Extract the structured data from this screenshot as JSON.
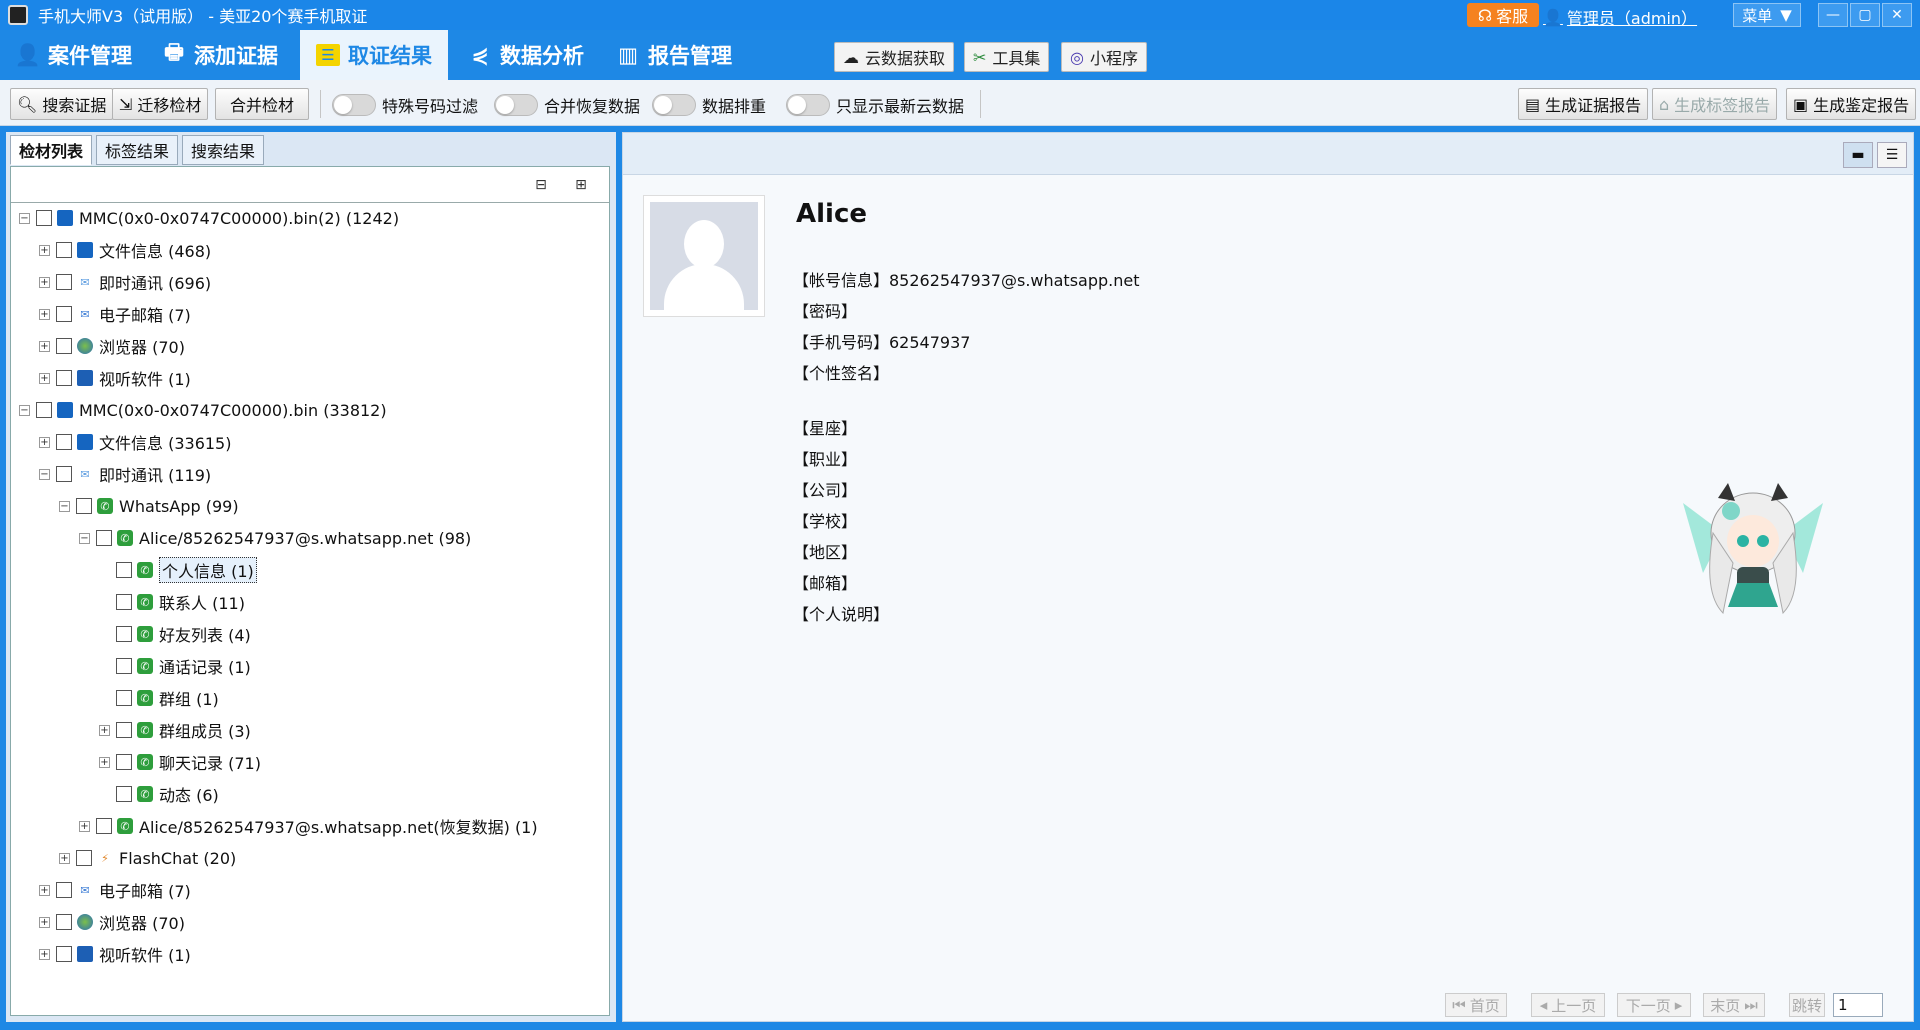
{
  "titlebar": {
    "title": "手机大师V3（试用版） - 美亚20个赛手机取证",
    "kefu": "客服",
    "admin": "管理员（admin）",
    "menu": "菜单"
  },
  "mainnav": {
    "items": [
      "案件管理",
      "添加证据",
      "取证结果",
      "数据分析",
      "报告管理"
    ],
    "active_index": 2,
    "cloud": "云数据获取",
    "tools": "工具集",
    "miniapp": "小程序"
  },
  "toolbar": {
    "search": "搜索证据",
    "migrate": "迁移检材",
    "merge": "合并检材",
    "toggles": [
      "特殊号码过滤",
      "合并恢复数据",
      "数据排重",
      "只显示最新云数据"
    ],
    "gen_evidence": "生成证据报告",
    "gen_tag": "生成标签报告",
    "gen_appraisal": "生成鉴定报告"
  },
  "tabs": [
    "检材列表",
    "标签结果",
    "搜索结果"
  ],
  "tree": [
    {
      "label": "MMC(0x0-0x0747C00000).bin(2) (1242)",
      "icon": "phone-icon",
      "exp": "⊟"
    },
    {
      "label": "文件信息 (468)",
      "icon": "file-icon",
      "exp": "⊞"
    },
    {
      "label": "即时通讯 (696)",
      "icon": "chat-icon",
      "exp": "⊞"
    },
    {
      "label": "电子邮箱 (7)",
      "icon": "mail-icon",
      "exp": "⊞"
    },
    {
      "label": "浏览器 (70)",
      "icon": "globe-icon",
      "exp": "⊞"
    },
    {
      "label": "视听软件 (1)",
      "icon": "video-icon",
      "exp": "⊞"
    },
    {
      "label": "MMC(0x0-0x0747C00000).bin (33812)",
      "icon": "phone-icon",
      "exp": "⊟"
    },
    {
      "label": "文件信息 (33615)",
      "icon": "file-icon",
      "exp": "⊞"
    },
    {
      "label": "即时通讯 (119)",
      "icon": "chat-icon",
      "exp": "⊟"
    },
    {
      "label": "WhatsApp (99)",
      "icon": "whatsapp-icon",
      "exp": "⊟"
    },
    {
      "label": "Alice/85262547937@s.whatsapp.net (98)",
      "icon": "whatsapp-icon",
      "exp": "⊟"
    },
    {
      "label": "个人信息 (1)",
      "icon": "whatsapp-icon",
      "exp": ""
    },
    {
      "label": "联系人 (11)",
      "icon": "whatsapp-icon",
      "exp": ""
    },
    {
      "label": "好友列表 (4)",
      "icon": "whatsapp-icon",
      "exp": ""
    },
    {
      "label": "通话记录 (1)",
      "icon": "whatsapp-icon",
      "exp": ""
    },
    {
      "label": "群组 (1)",
      "icon": "whatsapp-icon",
      "exp": ""
    },
    {
      "label": "群组成员 (3)",
      "icon": "whatsapp-icon",
      "exp": "⊞"
    },
    {
      "label": "聊天记录 (71)",
      "icon": "whatsapp-icon",
      "exp": "⊞"
    },
    {
      "label": "动态 (6)",
      "icon": "whatsapp-icon",
      "exp": ""
    },
    {
      "label": "Alice/85262547937@s.whatsapp.net(恢复数据) (1)",
      "icon": "whatsapp-icon",
      "exp": "⊞"
    },
    {
      "label": "FlashChat (20)",
      "icon": "flash-icon",
      "exp": "⊞"
    },
    {
      "label": "电子邮箱 (7)",
      "icon": "mail-icon",
      "exp": "⊞"
    },
    {
      "label": "浏览器 (70)",
      "icon": "globe-icon",
      "exp": "⊞"
    },
    {
      "label": "视听软件 (1)",
      "icon": "video-icon",
      "exp": "⊞"
    }
  ],
  "detail": {
    "name": "Alice",
    "fields": [
      "【帐号信息】85262547937@s.whatsapp.net",
      "【密码】",
      "【手机号码】62547937",
      "【个性签名】",
      "【星座】",
      "【职业】",
      "【公司】",
      "【学校】",
      "【地区】",
      "【邮箱】",
      "【个人说明】"
    ]
  },
  "pager": {
    "first": "首页",
    "prev": "上一页",
    "next": "下一页",
    "last": "末页",
    "jump": "跳转",
    "page": "1"
  },
  "colors": {
    "brand": "#1e88e5",
    "kefu": "#f5821f",
    "whatsapp": "#2e9e3c"
  }
}
